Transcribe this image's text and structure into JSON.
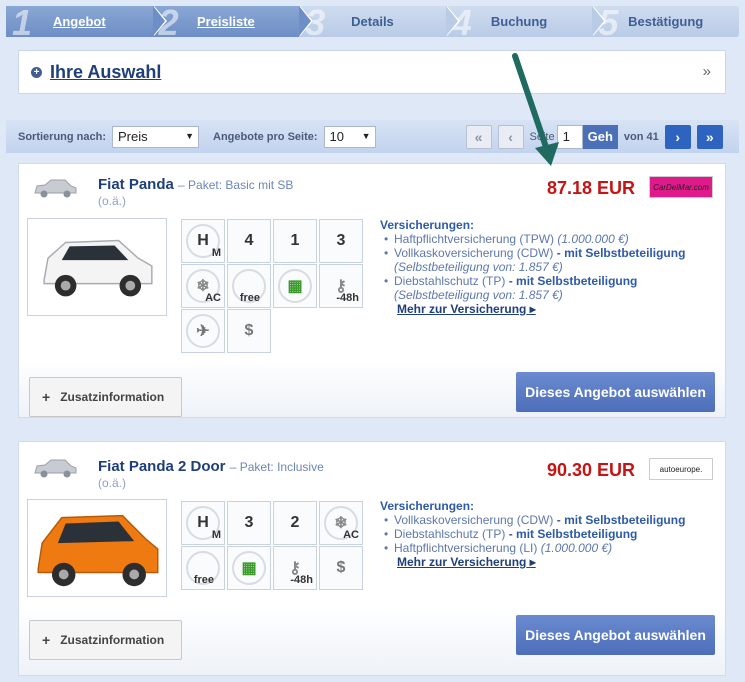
{
  "steps": [
    {
      "num": "1",
      "label": "Angebot",
      "state": "done"
    },
    {
      "num": "2",
      "label": "Preisliste",
      "state": "done"
    },
    {
      "num": "3",
      "label": "Details",
      "state": "todo"
    },
    {
      "num": "4",
      "label": "Buchung",
      "state": "todo"
    },
    {
      "num": "5",
      "label": "Bestätigung",
      "state": "todo"
    }
  ],
  "selection": {
    "title": "Ihre Auswahl",
    "chevron": "»"
  },
  "sortbar": {
    "sort_label": "Sortierung nach:",
    "sort_value": "Preis",
    "per_page_label": "Angebote pro Seite:",
    "per_page_value": "10",
    "page_label": "Seite",
    "page_value": "1",
    "go_label": "Geh",
    "of_label": "von 41"
  },
  "offers": [
    {
      "name": "Fiat Panda",
      "package_label": "– Paket:",
      "package": "Basic mit SB",
      "oa": "(o.ä.)",
      "price": "87.18 EUR",
      "logo": "CarDelMar.com",
      "logo_color": "#e01a8b",
      "icons": [
        "manual-gear-icon",
        "4-doors-icon",
        "1-luggage-icon",
        "3-suitcase-icon",
        "air-conditioning-icon",
        "free-mileage-icon",
        "fuel-policy-icon",
        "min-age-48h-icon",
        "airport-fee-icon",
        "one-way-fee-icon"
      ],
      "insurance_title": "Versicherungen:",
      "insurance": [
        {
          "text": "Haftpflichtversicherung (TPW)",
          "extra": "(1.000.000 €)"
        },
        {
          "text": "Vollkaskoversicherung (CDW)",
          "bold": "- mit Selbstbeteiligung",
          "sub": "(Selbstbeteiligung von: 1.857 €)"
        },
        {
          "text": "Diebstahlschutz (TP)",
          "bold": "- mit Selbstbeteiligung",
          "sub": "(Selbstbeteiligung von: 1.857 €)"
        }
      ],
      "more": "Mehr zur Versicherung",
      "more_arrow": "▸",
      "info_button": "Zusatzinformation",
      "info_plus": "+",
      "choose_button": "Dieses Angebot auswählen",
      "car_color": "#f3f3f3"
    },
    {
      "name": "Fiat Panda 2 Door",
      "package_label": "– Paket:",
      "package": "Inclusive",
      "oa": "(o.ä.)",
      "price": "90.30 EUR",
      "logo": "autoeurope.",
      "logo_color": "#ffffff",
      "icons": [
        "manual-gear-icon",
        "3-doors-icon",
        "2-luggage-icon",
        "air-conditioning-icon",
        "free-mileage-icon",
        "fuel-policy-icon",
        "min-age-48h-icon",
        "one-way-fee-icon"
      ],
      "insurance_title": "Versicherungen:",
      "insurance": [
        {
          "text": "Vollkaskoversicherung (CDW)",
          "bold": "- mit Selbstbeteiligung"
        },
        {
          "text": "Diebstahlschutz (TP)",
          "bold": "- mit Selbstbeteiligung"
        },
        {
          "text": "Haftpflichtversicherung (LI)",
          "extra": "(1.000.000 €)"
        }
      ],
      "more": "Mehr zur Versicherung",
      "more_arrow": "▸",
      "info_button": "Zusatzinformation",
      "info_plus": "+",
      "choose_button": "Dieses Angebot auswählen",
      "car_color": "#f07a12"
    }
  ],
  "icon_labels": {
    "ac": "AC",
    "free": "free",
    "age": "-48h",
    "doors1": "4",
    "doors2": "3",
    "lug1": "1",
    "suit1": "3",
    "lug2": "2"
  },
  "colors": {
    "accent": "#4d6fb9",
    "price": "#c41414",
    "arrow": "#1f6b62"
  }
}
